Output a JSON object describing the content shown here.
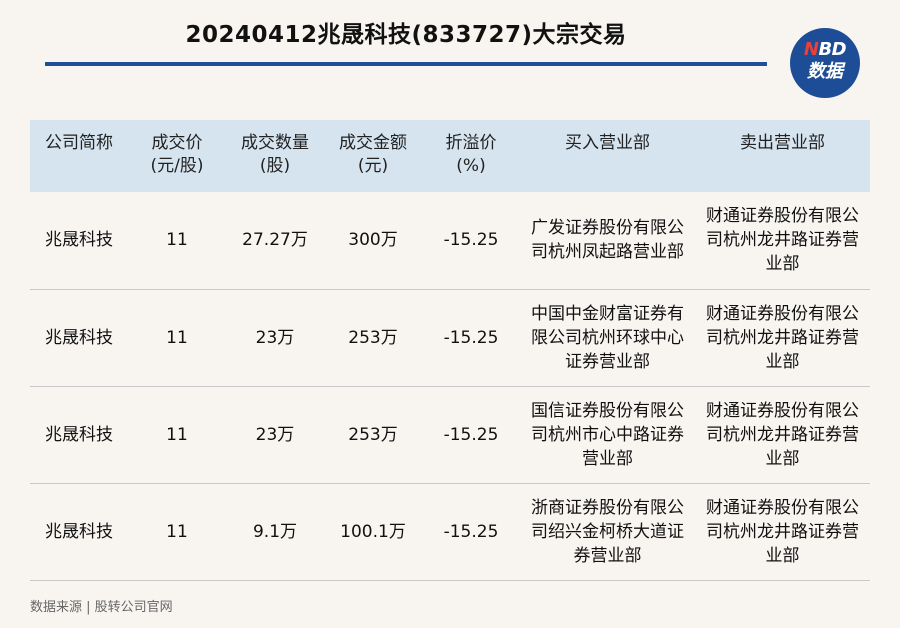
{
  "title": "20240412兆晟科技(833727)大宗交易",
  "logo": {
    "line1_n": "N",
    "line1_rest": "BD",
    "line2": "数据"
  },
  "table": {
    "headers": [
      {
        "line1": "公司简称",
        "line2": ""
      },
      {
        "line1": "成交价",
        "line2": "(元/股)"
      },
      {
        "line1": "成交数量",
        "line2": "(股)"
      },
      {
        "line1": "成交金额",
        "line2": "(元)"
      },
      {
        "line1": "折溢价",
        "line2": "(%)"
      },
      {
        "line1": "买入营业部",
        "line2": ""
      },
      {
        "line1": "卖出营业部",
        "line2": ""
      }
    ],
    "rows": [
      [
        "兆晟科技",
        "11",
        "27.27万",
        "300万",
        "-15.25",
        "广发证券股份有限公司杭州凤起路营业部",
        "财通证券股份有限公司杭州龙井路证券营业部"
      ],
      [
        "兆晟科技",
        "11",
        "23万",
        "253万",
        "-15.25",
        "中国中金财富证券有限公司杭州环球中心证券营业部",
        "财通证券股份有限公司杭州龙井路证券营业部"
      ],
      [
        "兆晟科技",
        "11",
        "23万",
        "253万",
        "-15.25",
        "国信证券股份有限公司杭州市心中路证券营业部",
        "财通证券股份有限公司杭州龙井路证券营业部"
      ],
      [
        "兆晟科技",
        "11",
        "9.1万",
        "100.1万",
        "-15.25",
        "浙商证券股份有限公司绍兴金柯桥大道证券营业部",
        "财通证券股份有限公司杭州龙井路证券营业部"
      ]
    ]
  },
  "source": "数据来源 | 股转公司官网",
  "colors": {
    "accent": "#1f4e9a",
    "header_bg": "#d6e4f0",
    "page_bg": "#f8f5f1",
    "logo_red": "#e8403a"
  }
}
